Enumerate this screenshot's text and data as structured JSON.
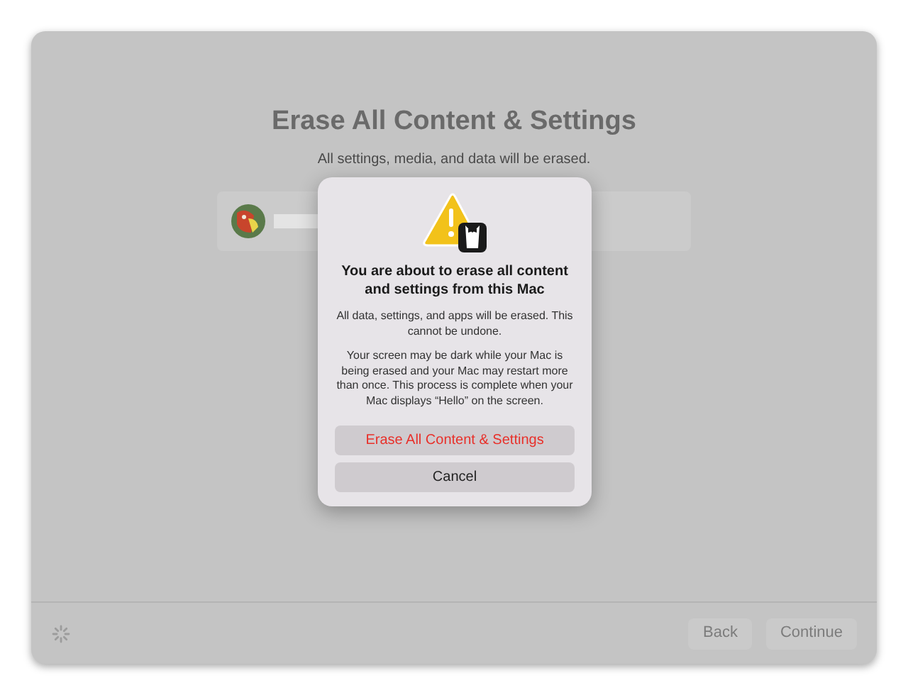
{
  "window": {
    "title": "Erase All Content & Settings",
    "subtitle": "All settings, media, and data will be erased."
  },
  "footer": {
    "buttons": [
      {
        "label": "Back",
        "disabled": true
      },
      {
        "label": "Continue",
        "disabled": true
      }
    ]
  },
  "dialog": {
    "heading": "You are about to erase all content and settings from this Mac",
    "paragraphs": [
      "All data, settings, and apps will be erased. This cannot be undone.",
      "Your screen may be dark while your Mac is being erased and your Mac may restart more than once. This process is complete when your Mac displays “Hello” on the screen."
    ],
    "buttons": [
      {
        "label": "Erase All Content & Settings",
        "kind": "destructive"
      },
      {
        "label": "Cancel",
        "kind": "normal"
      }
    ]
  }
}
